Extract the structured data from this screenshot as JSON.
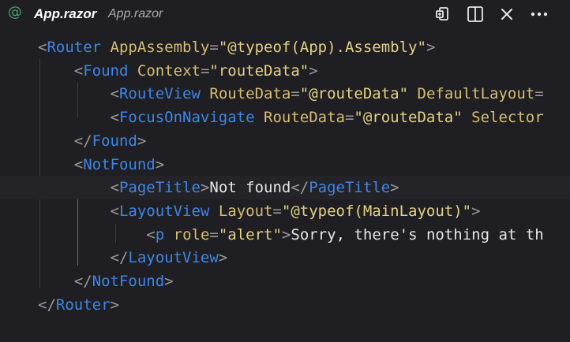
{
  "tab": {
    "icon": "@",
    "title": "App.razor",
    "description": "App.razor"
  },
  "actions": {
    "open_changes_icon": "open-changes-icon",
    "split_editor_icon": "split-editor-icon",
    "close_icon": "close-icon",
    "more_actions_icon": "more-actions-icon"
  },
  "colors": {
    "background": "#1f1f23",
    "tag": "#3f86e6",
    "attribute": "#d7bd72",
    "string": "#e4d186",
    "text": "#e6e6e6"
  },
  "code": {
    "lines": [
      "<Router AppAssembly=\"@typeof(App).Assembly\">",
      "    <Found Context=\"routeData\">",
      "        <RouteView RouteData=\"@routeData\" DefaultLayout=",
      "        <FocusOnNavigate RouteData=\"@routeData\" Selector",
      "    </Found>",
      "    <NotFound>",
      "        <PageTitle>Not found</PageTitle>",
      "        <LayoutView Layout=\"@typeof(MainLayout)\">",
      "            <p role=\"alert\">Sorry, there's nothing at th",
      "        </LayoutView>",
      "    </NotFound>",
      "</Router>"
    ]
  }
}
